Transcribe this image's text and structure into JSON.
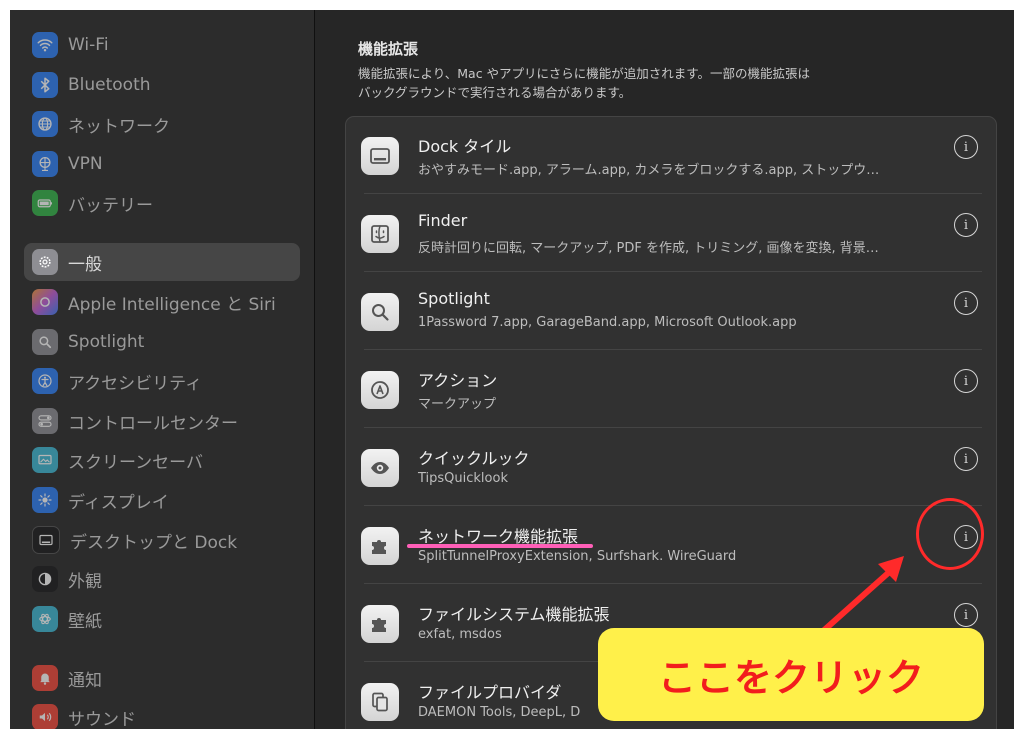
{
  "sidebar": {
    "items": [
      {
        "label": "Wi-Fi",
        "icon": "wifi-icon",
        "color": "#2f7ff6"
      },
      {
        "label": "Bluetooth",
        "icon": "bluetooth-icon",
        "color": "#2f7ff6"
      },
      {
        "label": "ネットワーク",
        "icon": "globe-icon",
        "color": "#2f7ff6"
      },
      {
        "label": "VPN",
        "icon": "vpn-globe-icon",
        "color": "#2f7ff6"
      },
      {
        "label": "バッテリー",
        "icon": "battery-icon",
        "color": "#35b34a"
      },
      {
        "label": "一般",
        "icon": "gear-icon",
        "color": "#8e8e93"
      },
      {
        "label": "Apple Intelligence と Siri",
        "icon": "siri-icon",
        "color": "#c45fd6"
      },
      {
        "label": "Spotlight",
        "icon": "magnifier-icon",
        "color": "#8e8e93"
      },
      {
        "label": "アクセシビリティ",
        "icon": "accessibility-icon",
        "color": "#2f7ff6"
      },
      {
        "label": "コントロールセンター",
        "icon": "control-center-icon",
        "color": "#8e8e93"
      },
      {
        "label": "スクリーンセーバ",
        "icon": "screensaver-icon",
        "color": "#3fb8d4"
      },
      {
        "label": "ディスプレイ",
        "icon": "sun-icon",
        "color": "#2f7ff6"
      },
      {
        "label": "デスクトップと Dock",
        "icon": "dock-icon",
        "color": "#1c1c1e"
      },
      {
        "label": "外観",
        "icon": "appearance-icon",
        "color": "#1c1c1e"
      },
      {
        "label": "壁紙",
        "icon": "wallpaper-icon",
        "color": "#3fb8d4"
      },
      {
        "label": "通知",
        "icon": "bell-icon",
        "color": "#f2483b"
      },
      {
        "label": "サウンド",
        "icon": "speaker-icon",
        "color": "#f2483b"
      }
    ]
  },
  "section": {
    "title": "機能拡張",
    "description_line1": "機能拡張により、Mac やアプリにさらに機能が追加されます。一部の機能拡張は",
    "description_line2": "バックグラウンドで実行される場合があります。"
  },
  "extensions": [
    {
      "title": "Dock タイル",
      "subtitle": "おやすみモード.app, アラーム.app, カメラをブロックする.app, ストップウ…",
      "icon": "dock-tile-icon"
    },
    {
      "title": "Finder",
      "subtitle": "反時計回りに回転, マークアップ, PDF を作成, トリミング, 画像を変換, 背景…",
      "icon": "finder-icon"
    },
    {
      "title": "Spotlight",
      "subtitle": "1Password 7.app, GarageBand.app, Microsoft Outlook.app",
      "icon": "spotlight-icon"
    },
    {
      "title": "アクション",
      "subtitle": "マークアップ",
      "icon": "markup-pen-icon"
    },
    {
      "title": "クイックルック",
      "subtitle": "TipsQuicklook",
      "icon": "eye-icon"
    },
    {
      "title": "ネットワーク機能拡張",
      "subtitle": "SplitTunnelProxyExtension, Surfshark. WireGuard",
      "icon": "puzzle-icon"
    },
    {
      "title": "ファイルシステム機能拡張",
      "subtitle": "exfat, msdos",
      "icon": "puzzle-icon"
    },
    {
      "title": "ファイルプロバイダ",
      "subtitle": "DAEMON Tools, DeepL, D",
      "icon": "documents-icon"
    }
  ],
  "info_symbol": "i",
  "callout": {
    "text": "ここをクリック",
    "bg": "#fff04a",
    "color": "#f21d1d"
  },
  "annotation_color": "#ff2a2a"
}
